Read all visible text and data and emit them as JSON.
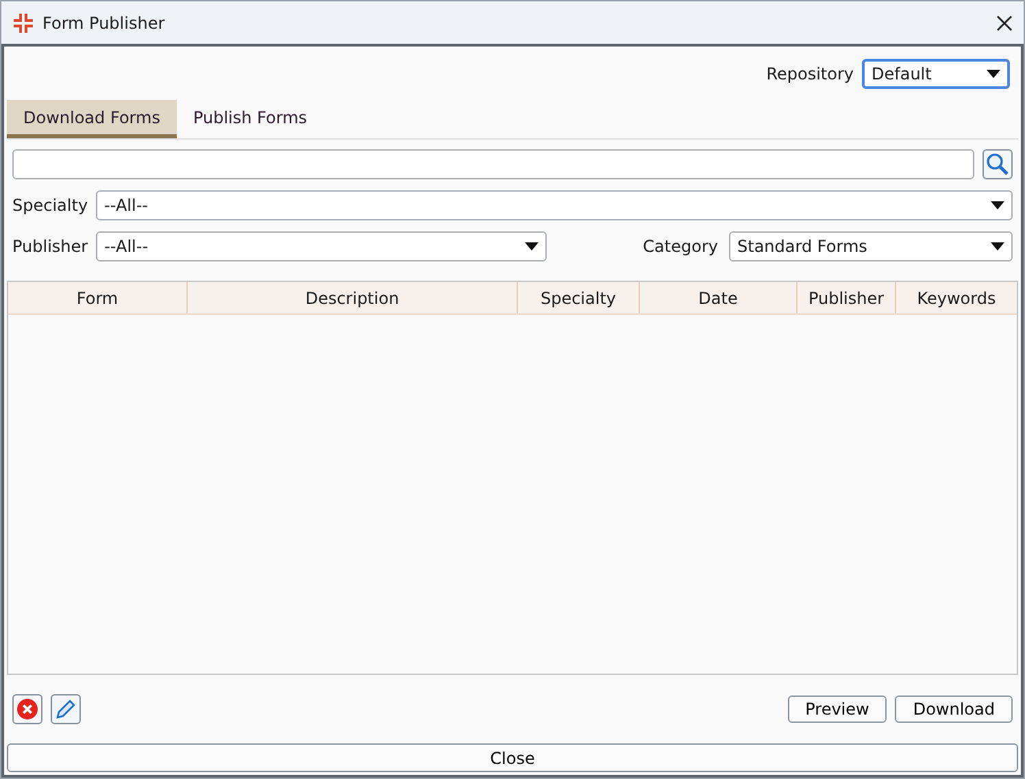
{
  "window": {
    "title": "Form Publisher"
  },
  "repository": {
    "label": "Repository",
    "value": "Default"
  },
  "tabs": [
    {
      "label": "Download Forms",
      "selected": true
    },
    {
      "label": "Publish Forms",
      "selected": false
    }
  ],
  "filters": {
    "specialty": {
      "label": "Specialty",
      "value": "--All--"
    },
    "publisher": {
      "label": "Publisher",
      "value": "--All--"
    },
    "category": {
      "label": "Category",
      "value": "Standard Forms"
    }
  },
  "table": {
    "columns": [
      "Form",
      "Description",
      "Specialty",
      "Date",
      "Publisher",
      "Keywords"
    ]
  },
  "buttons": [
    "Preview",
    "Download"
  ],
  "close_button": "Close"
}
